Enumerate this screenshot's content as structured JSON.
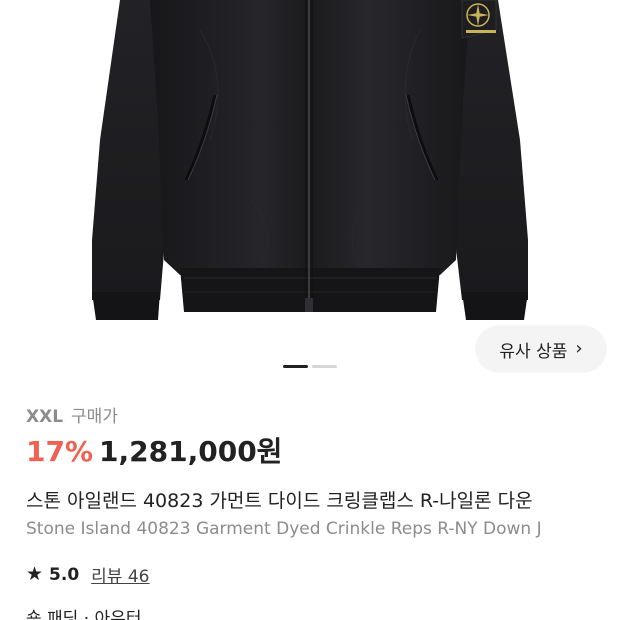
{
  "product": {
    "size": "XXL",
    "size_suffix": "구매가",
    "discount": "17%",
    "price": "1,281,000원",
    "title_ko": "스톤 아일랜드 40823 가먼트 다이드 크링클랩스 R-나일론 다운",
    "title_en": "Stone Island 40823 Garment Dyed Crinkle Reps R-NY Down J",
    "rating": "5.0",
    "review_label": "리뷰 46",
    "partial_bottom_text": "숏 패딩 · 아우터"
  },
  "image": {
    "similar_button_label": "유사 상품",
    "carousel_total": 2,
    "carousel_active": 1
  },
  "icons": {
    "star": "star-icon",
    "chevron": "chevron-right-icon"
  },
  "colors": {
    "discount": "#ef6253",
    "price": "#222222",
    "muted": "#8c8c8c",
    "jacket": "#1c1c1f"
  }
}
